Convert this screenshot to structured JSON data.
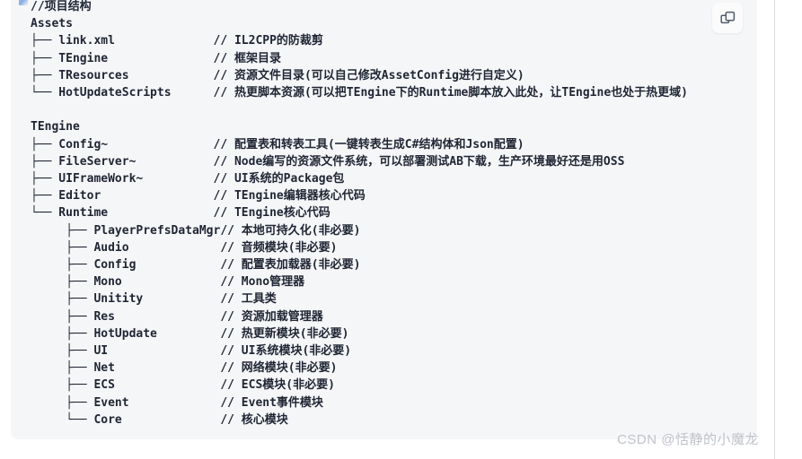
{
  "card": {
    "background_color": "#f5f6f8",
    "text_color": "#1f2533"
  },
  "copy_button": {
    "icon": "copy-icon",
    "label": ""
  },
  "watermark": {
    "text": "CSDN @恬静的小魔龙"
  },
  "code": {
    "language": "plaintext",
    "lines": [
      "//项目结构",
      "Assets",
      "├── link.xml              // IL2CPP的防裁剪",
      "├── TEngine               // 框架目录",
      "├── TResources            // 资源文件目录(可以自己修改AssetConfig进行自定义)",
      "└── HotUpdateScripts      // 热更脚本资源(可以把TEngine下的Runtime脚本放入此处，让TEngine也处于热更域)",
      "",
      "TEngine",
      "├── Config~               // 配置表和转表工具(一键转表生成C#结构体和Json配置)",
      "├── FileServer~           // Node编写的资源文件系统，可以部署测试AB下载，生产环境最好还是用OSS",
      "├── UIFrameWork~          // UI系统的Package包",
      "├── Editor                // TEngine编辑器核心代码",
      "└── Runtime               // TEngine核心代码",
      "     ├── PlayerPrefsDataMgr// 本地可持久化(非必要)",
      "     ├── Audio             // 音频模块(非必要)",
      "     ├── Config            // 配置表加载器(非必要)",
      "     ├── Mono              // Mono管理器",
      "     ├── Unitity           // 工具类",
      "     ├── Res               // 资源加载管理器",
      "     ├── HotUpdate         // 热更新模块(非必要)",
      "     ├── UI                // UI系统模块(非必要)",
      "     ├── Net               // 网络模块(非必要)",
      "     ├── ECS               // ECS模块(非必要)",
      "     ├── Event             // Event事件模块",
      "     └── Core              // 核心模块"
    ]
  }
}
